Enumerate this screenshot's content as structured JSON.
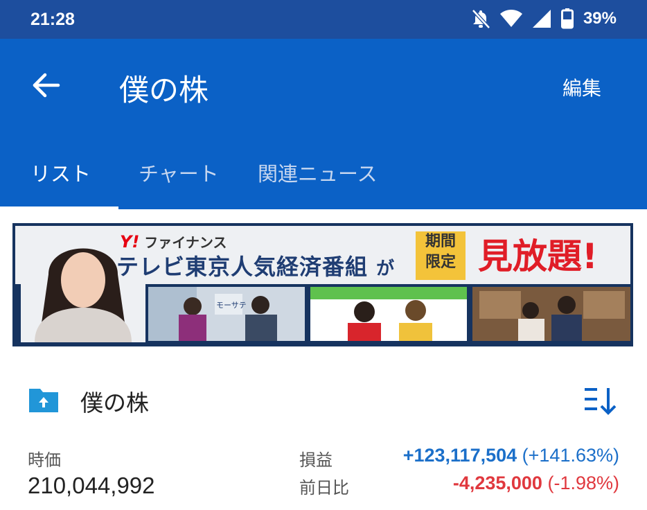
{
  "status_bar": {
    "time": "21:28",
    "battery": "39%"
  },
  "app_bar": {
    "title": "僕の株",
    "edit_label": "編集"
  },
  "tabs": [
    {
      "label": "リスト",
      "active": true
    },
    {
      "label": "チャート",
      "active": false
    },
    {
      "label": "関連ニュース",
      "active": false
    }
  ],
  "banner": {
    "brand_logo": "Y!",
    "brand_text": "ファイナンス",
    "headline": "テレビ東京人気経済番組",
    "particle": "が",
    "period_line1": "期間",
    "period_line2": "限定",
    "cta": "見放題!",
    "thumb_caption": "モーサテ"
  },
  "portfolio": {
    "name": "僕の株",
    "market_value_label": "時価",
    "market_value": "210,044,992",
    "profit_label": "損益",
    "profit_value": "+123,117,504",
    "profit_pct": "(+141.63%)",
    "day_change_label": "前日比",
    "day_change_value": "-4,235,000",
    "day_change_pct": "(-1.98%)"
  },
  "colors": {
    "status_bar": "#1d4e9e",
    "app_bar": "#0b61c6",
    "positive": "#1b6fc9",
    "negative": "#e0383e",
    "folder": "#2196d8"
  }
}
